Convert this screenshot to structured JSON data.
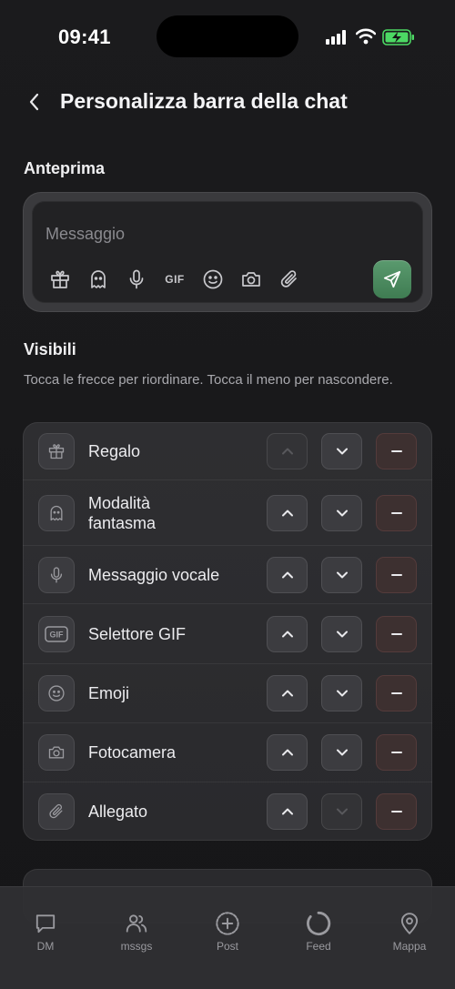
{
  "status_bar": {
    "time": "09:41"
  },
  "header": {
    "title": "Personalizza barra della chat"
  },
  "preview": {
    "section_title": "Anteprima",
    "placeholder": "Messaggio",
    "gif_label": "GIF",
    "icons": [
      "gift-icon",
      "ghost-icon",
      "microphone-icon",
      "gif-icon",
      "emoji-icon",
      "camera-icon",
      "paperclip-icon"
    ]
  },
  "visible": {
    "section_title": "Visibili",
    "hint": "Tocca le frecce per riordinare. Tocca il meno per nascondere.",
    "items": [
      {
        "label": "Regalo",
        "icon": "gift-icon",
        "up_enabled": false,
        "down_enabled": true
      },
      {
        "label": "Modalità fantasma",
        "icon": "ghost-icon",
        "up_enabled": true,
        "down_enabled": true
      },
      {
        "label": "Messaggio vocale",
        "icon": "microphone-icon",
        "up_enabled": true,
        "down_enabled": true
      },
      {
        "label": "Selettore GIF",
        "icon": "gif-icon",
        "icon_text": "GIF",
        "up_enabled": true,
        "down_enabled": true
      },
      {
        "label": "Emoji",
        "icon": "emoji-icon",
        "up_enabled": true,
        "down_enabled": true
      },
      {
        "label": "Fotocamera",
        "icon": "camera-icon",
        "up_enabled": true,
        "down_enabled": true
      },
      {
        "label": "Allegato",
        "icon": "paperclip-icon",
        "up_enabled": true,
        "down_enabled": false
      }
    ]
  },
  "tab_bar": {
    "tabs": [
      {
        "label": "DM",
        "icon": "chat-bubble-icon"
      },
      {
        "label": "mssgs",
        "icon": "people-icon"
      },
      {
        "label": "Post",
        "icon": "plus-circle-icon"
      },
      {
        "label": "Feed",
        "icon": "circle-icon"
      },
      {
        "label": "Mappa",
        "icon": "map-pin-icon"
      }
    ]
  },
  "colors": {
    "background": "#161618",
    "card": "#2e2e31",
    "accent_send": "#4a8a5e",
    "battery_green": "#4cd964",
    "text_secondary": "#a9a9ae"
  }
}
